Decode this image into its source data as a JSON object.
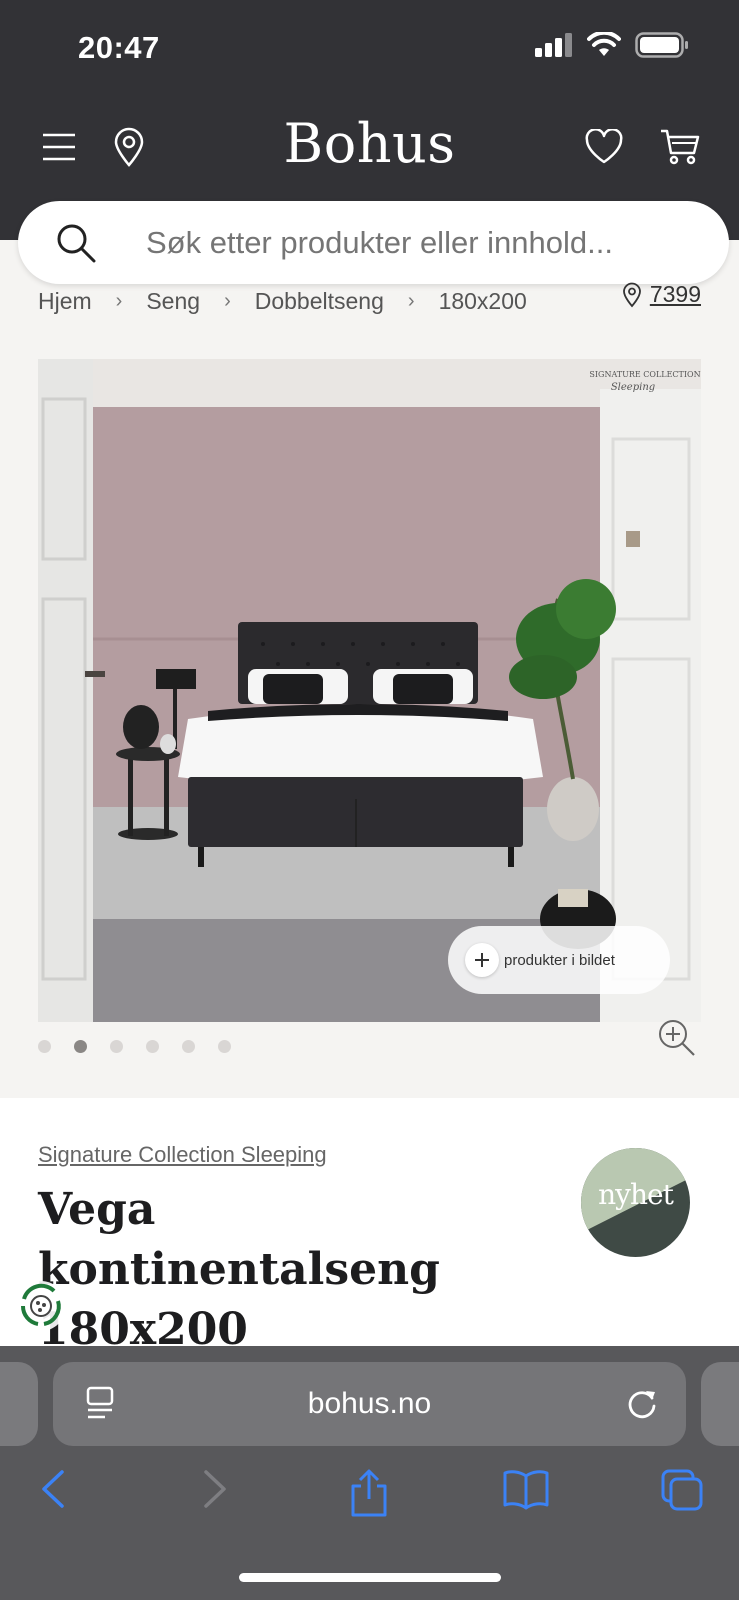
{
  "status": {
    "time": "20:47"
  },
  "header": {
    "brand": "Bohus"
  },
  "search": {
    "placeholder": "Søk etter produkter eller innhold..."
  },
  "breadcrumb": [
    "Hjem",
    "Seng",
    "Dobbeltseng",
    "180x200"
  ],
  "store": {
    "number": "7399"
  },
  "hero": {
    "watermark_line1": "SIGNATURE COLLECTION",
    "watermark_line2": "Sleeping",
    "chip_label": "produkter i bildet",
    "pager_count": 6,
    "pager_active": 1
  },
  "product": {
    "collection": "Signature Collection Sleeping",
    "title": "Vega kontinentalseng 180x200",
    "badge": "nyhet"
  },
  "browser": {
    "url": "bohus.no"
  },
  "colors": {
    "header_bg": "#323236",
    "accent_blue": "#3b82f6",
    "badge_light": "#b9c8b1",
    "badge_dark": "#3f4a45"
  }
}
